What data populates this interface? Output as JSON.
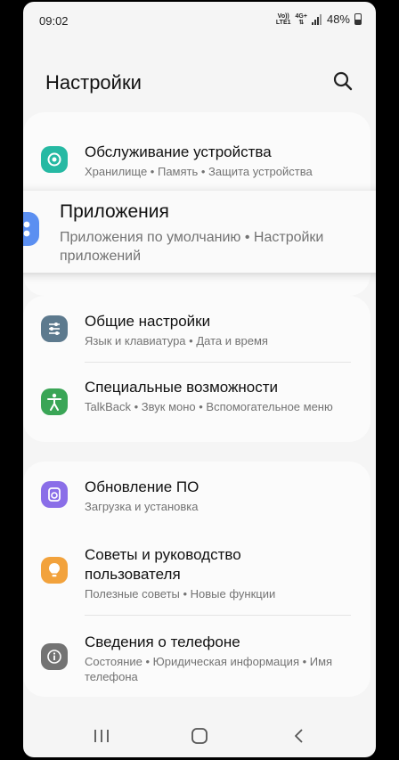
{
  "status_bar": {
    "time": "09:02",
    "volte_top": "Vo))",
    "volte_bottom": "LTE1",
    "network": "4G+",
    "battery": "48%"
  },
  "header": {
    "title": "Настройки",
    "search_icon": "search-icon"
  },
  "items": {
    "device_care": {
      "title": "Обслуживание устройства",
      "subtitle": "Хранилище • Память • Защита устройства",
      "icon": "device-care-icon",
      "color": "#26b9a3"
    },
    "apps": {
      "title": "Приложения",
      "subtitle": "Приложения по умолчанию • Настройки приложений",
      "icon": "apps-icon",
      "color": "#5b8ff1"
    },
    "general": {
      "title": "Общие настройки",
      "subtitle": "Язык и клавиатура • Дата и время",
      "icon": "sliders-icon",
      "color": "#5d7a8e"
    },
    "accessibility": {
      "title": "Специальные возможности",
      "subtitle": "TalkBack • Звук моно • Вспомогательное меню",
      "icon": "accessibility-icon",
      "color": "#3aa556"
    },
    "software_update": {
      "title": "Обновление ПО",
      "subtitle": "Загрузка и установка",
      "icon": "software-update-icon",
      "color": "#8a6ee8"
    },
    "tips": {
      "title": "Советы и руководство пользователя",
      "subtitle": "Полезные советы • Новые функции",
      "icon": "lightbulb-icon",
      "color": "#f2a23c"
    },
    "about": {
      "title": "Сведения о телефоне",
      "subtitle": "Состояние • Юридическая информация • Имя телефона",
      "icon": "info-icon",
      "color": "#737373"
    }
  },
  "nav": {
    "recents_icon": "recents-icon",
    "home_icon": "home-icon",
    "back_icon": "back-icon"
  }
}
